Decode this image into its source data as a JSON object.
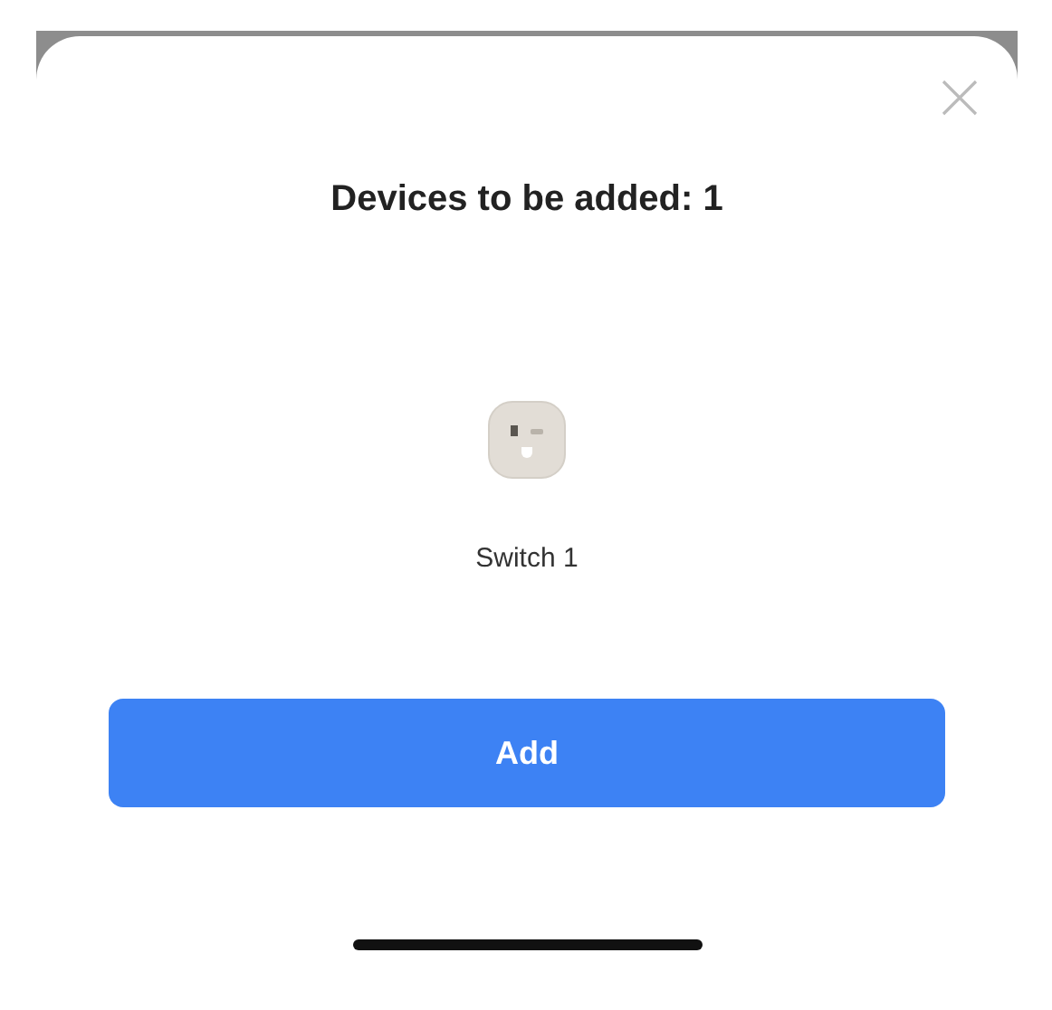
{
  "dialog": {
    "title": "Devices to be added: 1",
    "devices": [
      {
        "name": "Switch 1"
      }
    ],
    "button": "Add"
  }
}
